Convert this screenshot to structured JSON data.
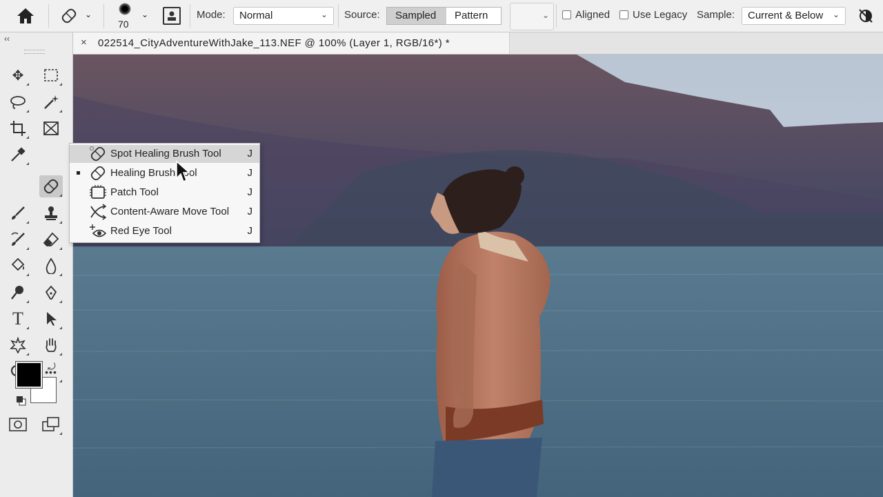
{
  "options_bar": {
    "brush_size": "70",
    "mode_label": "Mode:",
    "mode_value": "Normal",
    "source_label": "Source:",
    "source_sampled": "Sampled",
    "source_pattern": "Pattern",
    "aligned_label": "Aligned",
    "aligned_checked": false,
    "use_legacy_label": "Use Legacy",
    "use_legacy_checked": false,
    "sample_label": "Sample:",
    "sample_value": "Current & Below"
  },
  "document_tab": {
    "title": "022514_CityAdventureWithJake_113.NEF @ 100% (Layer 1, RGB/16*) *",
    "close": "×"
  },
  "toolbox": {
    "collapse": "‹‹",
    "tools": [
      {
        "name": "move-tool-icon",
        "glyph": "✥"
      },
      {
        "name": "marquee-tool-icon",
        "glyph": "⬚"
      },
      {
        "name": "lasso-tool-icon",
        "glyph": "◯"
      },
      {
        "name": "magic-wand-tool-icon",
        "glyph": "✦"
      },
      {
        "name": "crop-tool-icon",
        "glyph": "⌗"
      },
      {
        "name": "frame-tool-icon",
        "glyph": "☒"
      },
      {
        "name": "eyedropper-tool-icon",
        "glyph": "✎"
      },
      {
        "name": "healing-brush-tool-icon",
        "glyph": "✚"
      },
      {
        "name": "brush-tool-icon",
        "glyph": "✐"
      },
      {
        "name": "clone-stamp-tool-icon",
        "glyph": "♟"
      },
      {
        "name": "history-brush-tool-icon",
        "glyph": "✑"
      },
      {
        "name": "eraser-tool-icon",
        "glyph": "◪"
      },
      {
        "name": "paint-bucket-tool-icon",
        "glyph": "◈"
      },
      {
        "name": "blur-tool-icon",
        "glyph": "💧"
      },
      {
        "name": "dodge-tool-icon",
        "glyph": "●"
      },
      {
        "name": "pen-tool-icon",
        "glyph": "✒"
      },
      {
        "name": "type-tool-icon",
        "glyph": "T"
      },
      {
        "name": "path-selection-tool-icon",
        "glyph": "➤"
      },
      {
        "name": "custom-shape-tool-icon",
        "glyph": "✿"
      },
      {
        "name": "hand-tool-icon",
        "glyph": "✋"
      },
      {
        "name": "zoom-tool-icon",
        "glyph": "⚲"
      },
      {
        "name": "more-tools-icon",
        "glyph": "•••"
      }
    ]
  },
  "flyout_menu": {
    "items": [
      {
        "label": "Spot Healing Brush Tool",
        "shortcut": "J",
        "icon": "spot-healing-brush-icon",
        "current": false,
        "highlighted": true
      },
      {
        "label": "Healing Brush Tool",
        "shortcut": "J",
        "icon": "healing-brush-icon",
        "current": true,
        "highlighted": false
      },
      {
        "label": "Patch Tool",
        "shortcut": "J",
        "icon": "patch-tool-icon",
        "current": false,
        "highlighted": false
      },
      {
        "label": "Content-Aware Move Tool",
        "shortcut": "J",
        "icon": "content-aware-move-icon",
        "current": false,
        "highlighted": false
      },
      {
        "label": "Red Eye Tool",
        "shortcut": "J",
        "icon": "red-eye-tool-icon",
        "current": false,
        "highlighted": false
      }
    ]
  },
  "colors": {
    "foreground": "#000000",
    "background": "#ffffff",
    "sky": "#c3cfdc",
    "water": "#4d6d82",
    "hills": "#5a4c5e",
    "jacket": "#b5745a"
  }
}
